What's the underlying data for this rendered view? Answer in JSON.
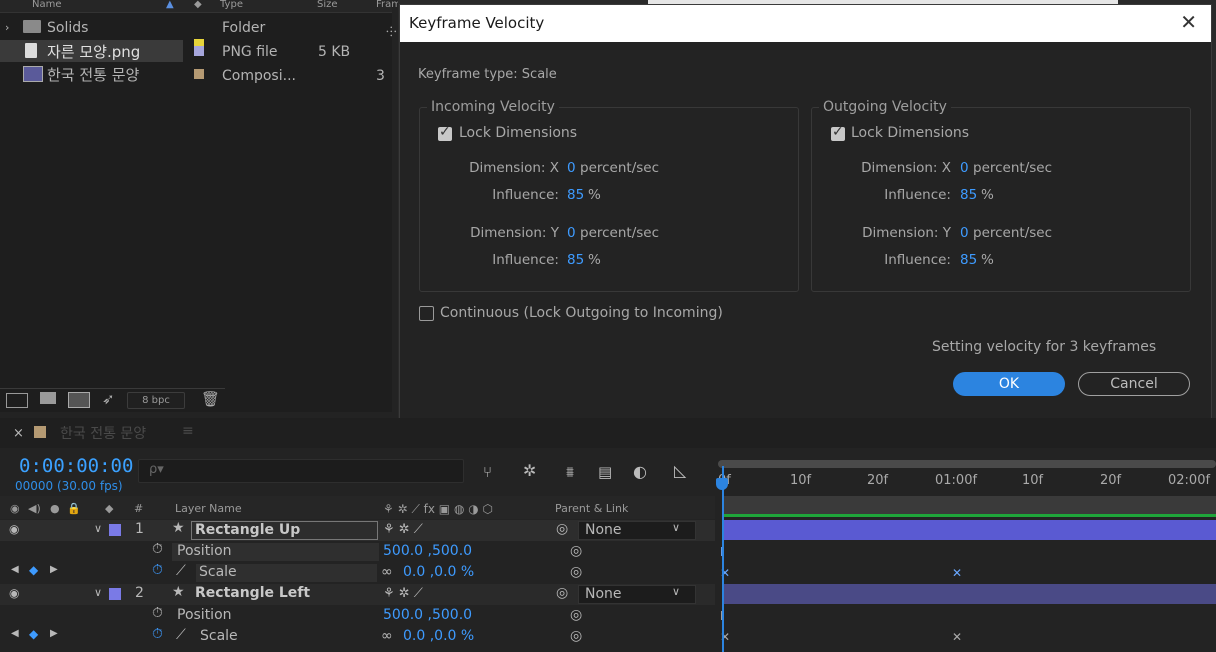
{
  "project": {
    "headers": {
      "name": "Name",
      "type": "Type",
      "size": "Size",
      "frame": "Fram"
    },
    "items": [
      {
        "name": "Solids",
        "type": "Folder",
        "size": "",
        "swatch": "#e6d43a",
        "icon": "folder-icon"
      },
      {
        "name": "자른 모양.png",
        "type": "PNG file",
        "size": "5 KB",
        "swatch": "#a6a6dc",
        "icon": "png-file-icon"
      },
      {
        "name": "한국 전통 문양",
        "type": "Composi...",
        "size": "3",
        "swatch": "#b59a73",
        "icon": "composition-icon"
      }
    ],
    "bpc": "8 bpc"
  },
  "dialog": {
    "title": "Keyframe Velocity",
    "keyframe_type": "Keyframe type: Scale",
    "incoming": {
      "label": "Incoming Velocity",
      "lock": "Lock Dimensions",
      "dim_x_label": "Dimension: X",
      "dim_x": "0",
      "dim_x_unit": "percent/sec",
      "influence_x_label": "Influence:",
      "influence_x": "85",
      "influence_x_unit": "%",
      "dim_y_label": "Dimension: Y",
      "dim_y": "0",
      "dim_y_unit": "percent/sec",
      "influence_y_label": "Influence:",
      "influence_y": "85",
      "influence_y_unit": "%"
    },
    "outgoing": {
      "label": "Outgoing Velocity",
      "lock": "Lock Dimensions",
      "dim_x_label": "Dimension: X",
      "dim_x": "0",
      "dim_x_unit": "percent/sec",
      "influence_x_label": "Influence:",
      "influence_x": "85",
      "influence_x_unit": "%",
      "dim_y_label": "Dimension: Y",
      "dim_y": "0",
      "dim_y_unit": "percent/sec",
      "influence_y_label": "Influence:",
      "influence_y": "85",
      "influence_y_unit": "%"
    },
    "continuous": "Continuous (Lock Outgoing to Incoming)",
    "status": "Setting velocity for 3 keyframes",
    "ok": "OK",
    "cancel": "Cancel"
  },
  "timeline": {
    "comp_name": "한국 전통 문양",
    "close": "×",
    "menu": "≡",
    "timecode": "0:00:00:00",
    "frames": "00000 (30.00 fps)",
    "search_placeholder": "ρ▾",
    "col_hash": "#",
    "col_layer_name": "Layer Name",
    "col_parent": "Parent & Link",
    "ruler": [
      "0f",
      "10f",
      "20f",
      "01:00f",
      "10f",
      "20f",
      "02:00f"
    ],
    "layers": [
      {
        "num": "1",
        "name": "Rectangle Up",
        "color": "#7a7ae6",
        "parent": "None",
        "position_label": "Position",
        "position": "500.0 ,500.0",
        "scale_label": "Scale",
        "scale": "0.0 ,0.0 %"
      },
      {
        "num": "2",
        "name": "Rectangle Left",
        "color": "#7a7ae6",
        "parent": "None",
        "position_label": "Position",
        "position": "500.0 ,500.0",
        "scale_label": "Scale",
        "scale": "0.0 ,0.0 %"
      }
    ]
  }
}
